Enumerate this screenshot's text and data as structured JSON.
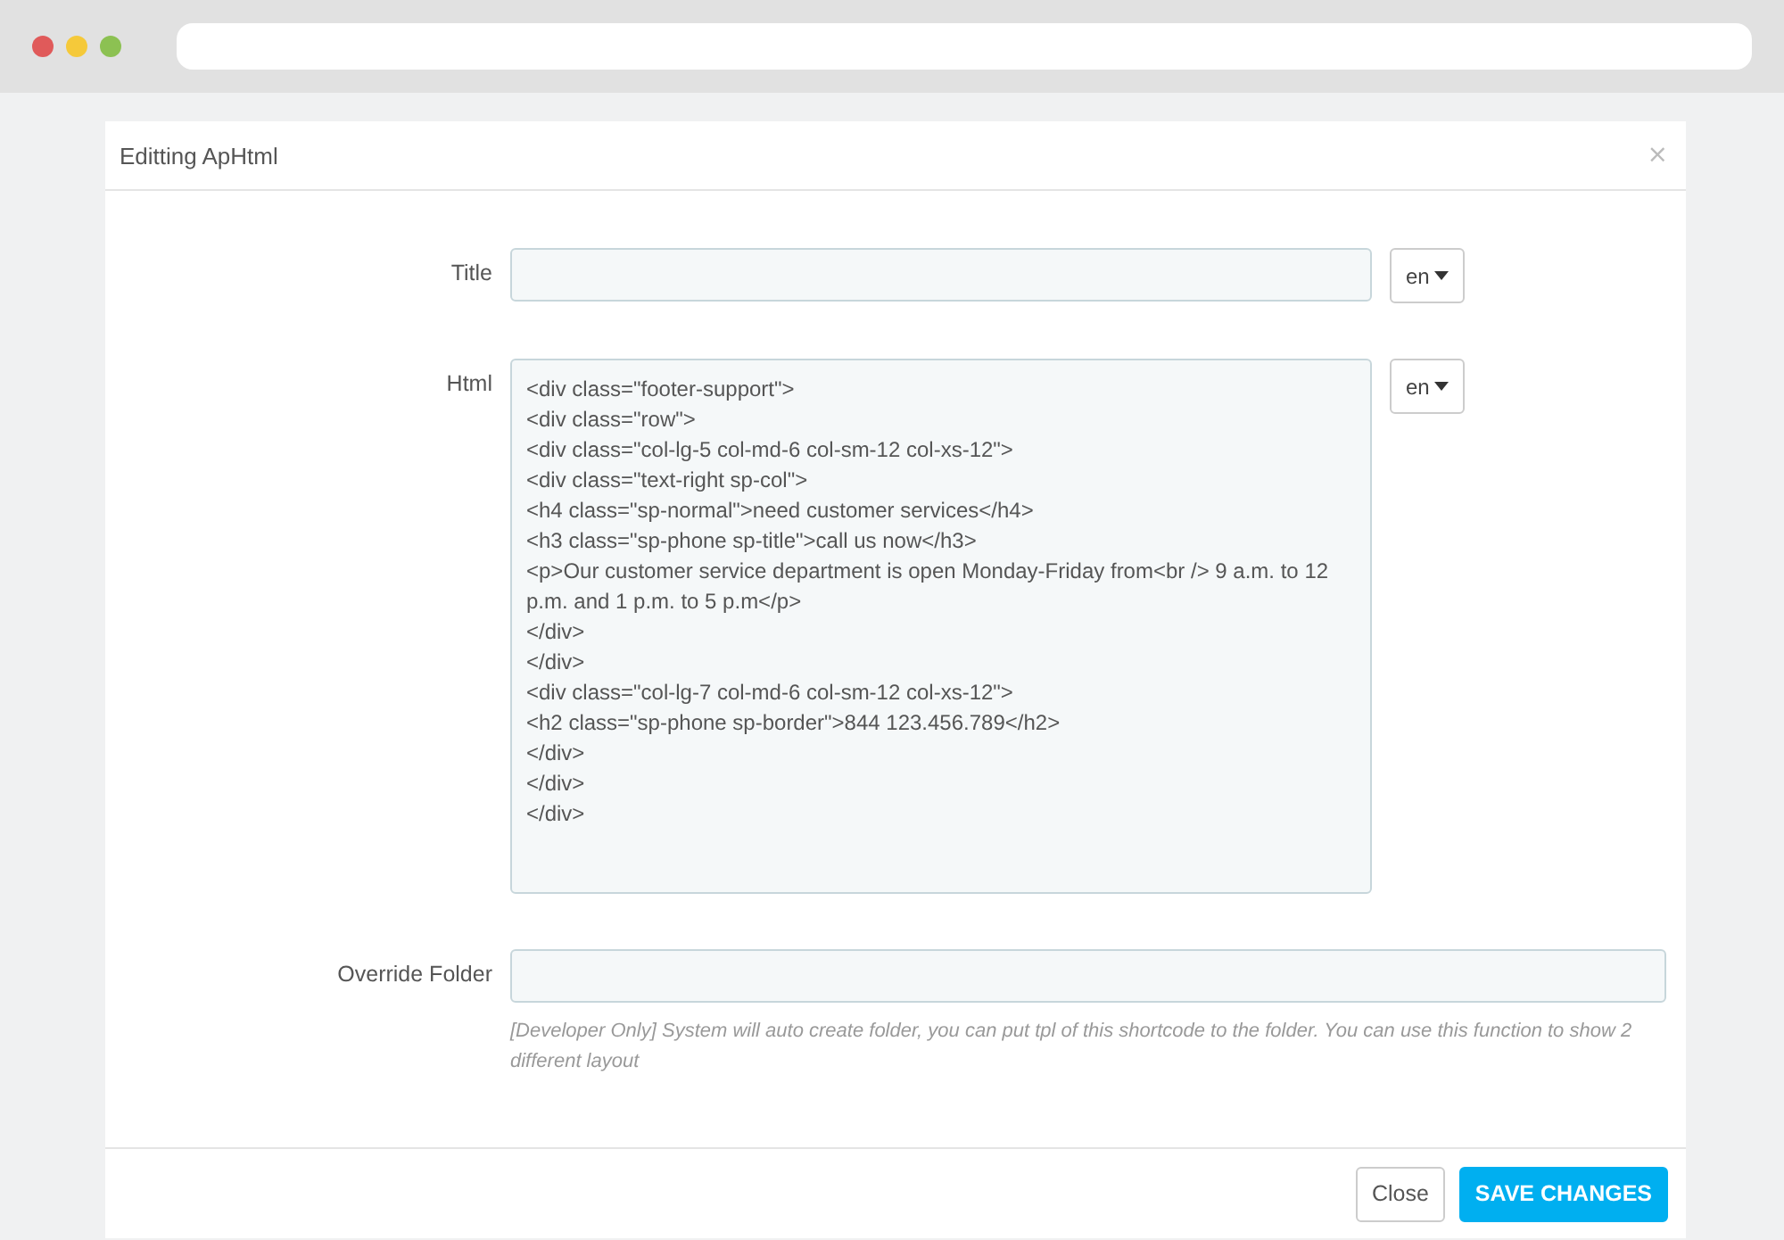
{
  "modal": {
    "title": "Editting ApHtml",
    "close_icon": "×",
    "fields": [
      {
        "kind": "input",
        "label": "Title",
        "lang": "en"
      },
      {
        "kind": "textarea",
        "label": "Html",
        "lang": "en",
        "lines": [
          "<div class=\"footer-support\">",
          "<div class=\"row\">",
          "<div class=\"col-lg-5 col-md-6 col-sm-12 col-xs-12\">",
          "<div class=\"text-right sp-col\">",
          "<h4 class=\"sp-normal\">need customer services</h4>",
          "<h3 class=\"sp-phone sp-title\">call us now</h3>",
          "<p>Our customer service department is open Monday-Friday from<br /> 9 a.m. to 12 p.m. and 1 p.m. to 5 p.m</p>",
          "</div>",
          "</div>",
          "<div class=\"col-lg-7 col-md-6 col-sm-12 col-xs-12\">",
          "<h2 class=\"sp-phone sp-border\">844 123.456.789</h2>",
          "</div>",
          "</div>",
          "</div>"
        ]
      },
      {
        "kind": "wide",
        "label": "Override Folder",
        "help": "[Developer Only] System will auto create folder, you can put tpl of this shortcode to the folder. You can use this function to show 2 different layout"
      }
    ],
    "buttons": [
      {
        "label": "Close",
        "kind": "default"
      },
      {
        "label": "SAVE CHANGES",
        "kind": "primary"
      }
    ]
  }
}
